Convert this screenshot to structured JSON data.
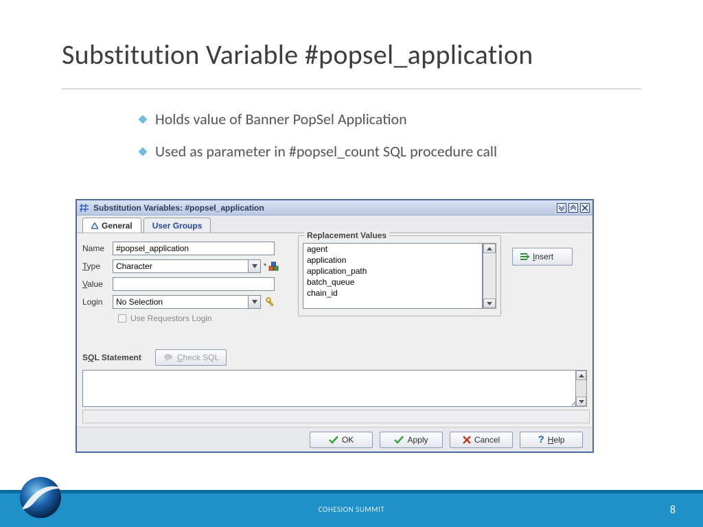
{
  "slide": {
    "title": "Substitution Variable #popsel_application",
    "bullets": [
      "Holds value of Banner PopSel Application",
      "Used as parameter in #popsel_count SQL procedure call"
    ],
    "footer_label": "COHESION SUMMIT",
    "page_number": "8"
  },
  "dialog": {
    "title": "Substitution Variables: #popsel_application",
    "tabs": {
      "general": "General",
      "user_groups": "User Groups"
    },
    "labels": {
      "name": "Name",
      "type": "Type",
      "value": "Value",
      "login": "Login",
      "use_requestors_login": "Use Requestors Login",
      "sql_statement": "SQL Statement",
      "replacement_values": "Replacement Values"
    },
    "fields": {
      "name": "#popsel_application",
      "type": "Character",
      "value": "",
      "login": "No Selection"
    },
    "replacement_values": [
      "agent",
      "application",
      "application_path",
      "batch_queue",
      "chain_id"
    ],
    "buttons": {
      "insert": "Insert",
      "check_sql": "Check SQL",
      "ok": "OK",
      "apply": "Apply",
      "cancel": "Cancel",
      "help": "Help"
    }
  }
}
